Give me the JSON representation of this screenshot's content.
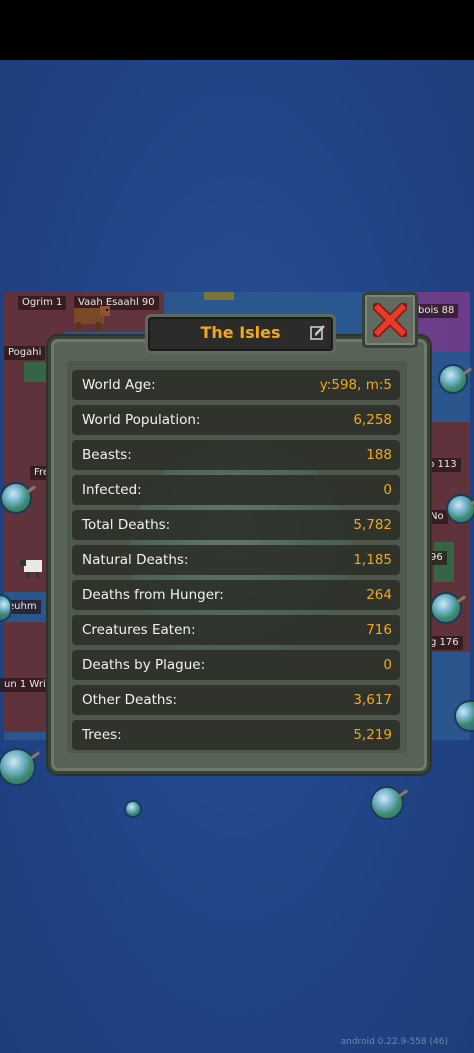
{
  "window": {
    "title": "The Isles",
    "version": "android 0.22.9-558 (46)"
  },
  "map_labels": [
    "Ogrim 1",
    "Vaah Esaahl 90",
    "Pogahi",
    "Fre",
    "euhm",
    "un 1 Wri",
    "bois 88",
    "p 113",
    "No",
    "96",
    "g 176"
  ],
  "stats": [
    {
      "label": "World Age:",
      "value": "y:598, m:5"
    },
    {
      "label": "World Population:",
      "value": "6,258"
    },
    {
      "label": "Beasts:",
      "value": "188"
    },
    {
      "label": "Infected:",
      "value": "0"
    },
    {
      "label": "Total Deaths:",
      "value": "5,782"
    },
    {
      "label": "Natural Deaths:",
      "value": "1,185"
    },
    {
      "label": "Deaths from Hunger:",
      "value": "264"
    },
    {
      "label": "Creatures Eaten:",
      "value": "716"
    },
    {
      "label": "Deaths by Plague:",
      "value": "0"
    },
    {
      "label": "Other Deaths:",
      "value": "3,617"
    },
    {
      "label": "Trees:",
      "value": "5,219"
    }
  ],
  "icons": {
    "close": "close-x-icon",
    "edit": "edit-icon",
    "bear": "bear-creature-icon",
    "sheep": "sheep-creature-icon"
  },
  "colors": {
    "accent": "#f2a81e",
    "close_x": "#e63a2a",
    "ocean": "#20407a"
  }
}
